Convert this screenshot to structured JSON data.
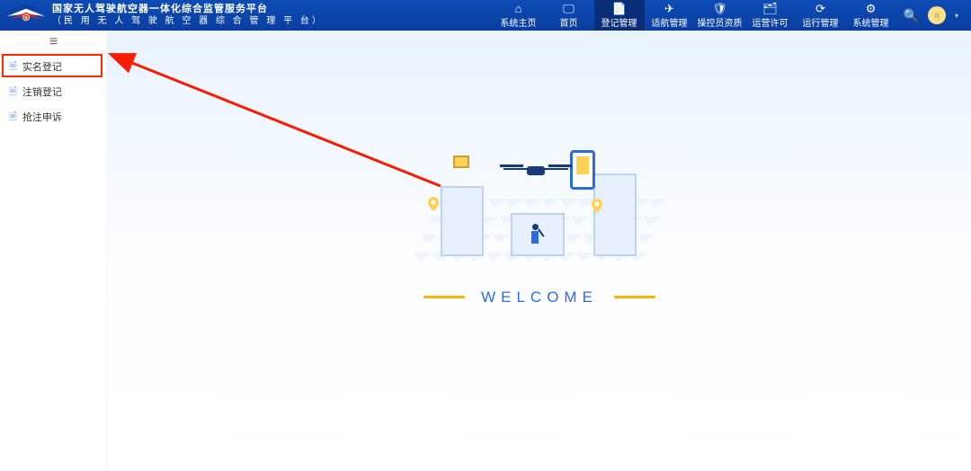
{
  "header": {
    "title_line1": "国家无人驾驶航空器一体化综合监管服务平台",
    "title_line2": "（民 用 无 人 驾 驶 航 空 器 综 合 管 理 平 台）",
    "nav": [
      {
        "icon": "home-icon",
        "glyph": "⌂",
        "label": "系统主页"
      },
      {
        "icon": "monitor-icon",
        "glyph": "🖵",
        "label": "首页"
      },
      {
        "icon": "register-icon",
        "glyph": "📄",
        "label": "登记管理",
        "active": true
      },
      {
        "icon": "airworthy-icon",
        "glyph": "✈",
        "label": "适航管理"
      },
      {
        "icon": "shield-icon",
        "glyph": "🛡",
        "label": "操控员资质"
      },
      {
        "icon": "license-icon",
        "glyph": "🗂",
        "label": "运营许可"
      },
      {
        "icon": "ops-icon",
        "glyph": "⟳",
        "label": "运行管理"
      },
      {
        "icon": "system-icon",
        "glyph": "⚙",
        "label": "系统管理"
      }
    ],
    "avatar_initial": "a"
  },
  "sidebar": {
    "items": [
      {
        "icon": "doc-icon",
        "label": "实名登记",
        "highlight": true
      },
      {
        "icon": "doc-icon",
        "label": "注销登记"
      },
      {
        "icon": "doc-icon",
        "label": "抢注申诉"
      }
    ]
  },
  "main": {
    "welcome": "WELCOME"
  }
}
